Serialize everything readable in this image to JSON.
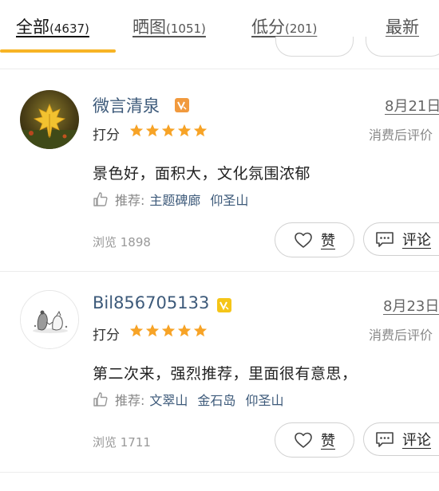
{
  "tabs": [
    {
      "label": "全部",
      "count": "(4637)",
      "active": true
    },
    {
      "label": "晒图",
      "count": "(1051)",
      "active": false
    },
    {
      "label": "低分",
      "count": "(201)",
      "active": false
    },
    {
      "label": "最新",
      "count": "",
      "active": false
    }
  ],
  "colors": {
    "accent": "#f7b425",
    "link": "#3d5a7a",
    "star": "#f7a326"
  },
  "reviews": [
    {
      "username": "微言清泉",
      "badge_color": "#f19a3e",
      "date": "8月21日",
      "score_label": "打分",
      "rating": 5,
      "status": "消费后评价",
      "content": "景色好，面积大，文化氛围浓郁",
      "rec_label": "推荐:",
      "rec_items": [
        "主题碑廊",
        "仰圣山"
      ],
      "views": "浏览 1898",
      "like_label": "赞",
      "comment_label": "评论"
    },
    {
      "username": "Bil856705133",
      "badge_color": "#f5c518",
      "date": "8月23日",
      "score_label": "打分",
      "rating": 5,
      "status": "消费后评价",
      "content": "第二次来，强烈推荐，里面很有意思，",
      "rec_label": "推荐:",
      "rec_items": [
        "文翠山",
        "金石岛",
        "仰圣山"
      ],
      "views": "浏览 1711",
      "like_label": "赞",
      "comment_label": "评论"
    }
  ]
}
